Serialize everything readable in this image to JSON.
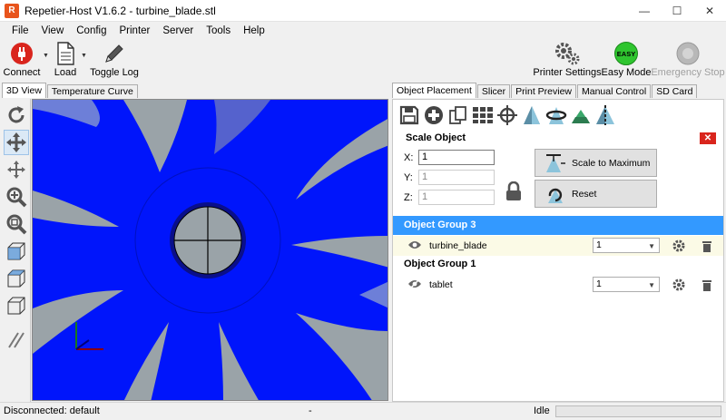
{
  "window": {
    "title": "Repetier-Host V1.6.2 - turbine_blade.stl",
    "app_icon_letter": "R",
    "minimize": "—",
    "maximize": "☐",
    "close": "✕"
  },
  "menu": [
    "File",
    "View",
    "Config",
    "Printer",
    "Server",
    "Tools",
    "Help"
  ],
  "toolbar": {
    "connect": "Connect",
    "load": "Load",
    "toggle_log": "Toggle Log",
    "printer_settings": "Printer Settings",
    "easy_mode": "Easy Mode",
    "easy_badge": "EASY",
    "emergency_stop": "Emergency Stop"
  },
  "left_tabs": [
    "3D View",
    "Temperature Curve"
  ],
  "right_tabs": [
    "Object Placement",
    "Slicer",
    "Print Preview",
    "Manual Control",
    "SD Card"
  ],
  "scale_object": {
    "title": "Scale Object",
    "x_label": "X:",
    "y_label": "Y:",
    "z_label": "Z:",
    "x_value": "1",
    "y_value": "1",
    "z_value": "1",
    "scale_to_max": "Scale to Maximum",
    "reset": "Reset"
  },
  "groups": [
    {
      "name": "Object Group 3",
      "object": "turbine_blade",
      "copies": "1"
    },
    {
      "name": "Object Group 1",
      "object": "tablet",
      "copies": "1"
    }
  ],
  "status": {
    "connection": "Disconnected: default",
    "middle": "-",
    "state": "Idle"
  },
  "colors": {
    "viewport_bg": "#0015fb",
    "selection": "#3399ff",
    "close_red": "#d9251d",
    "easy_green": "#2fc52f"
  }
}
